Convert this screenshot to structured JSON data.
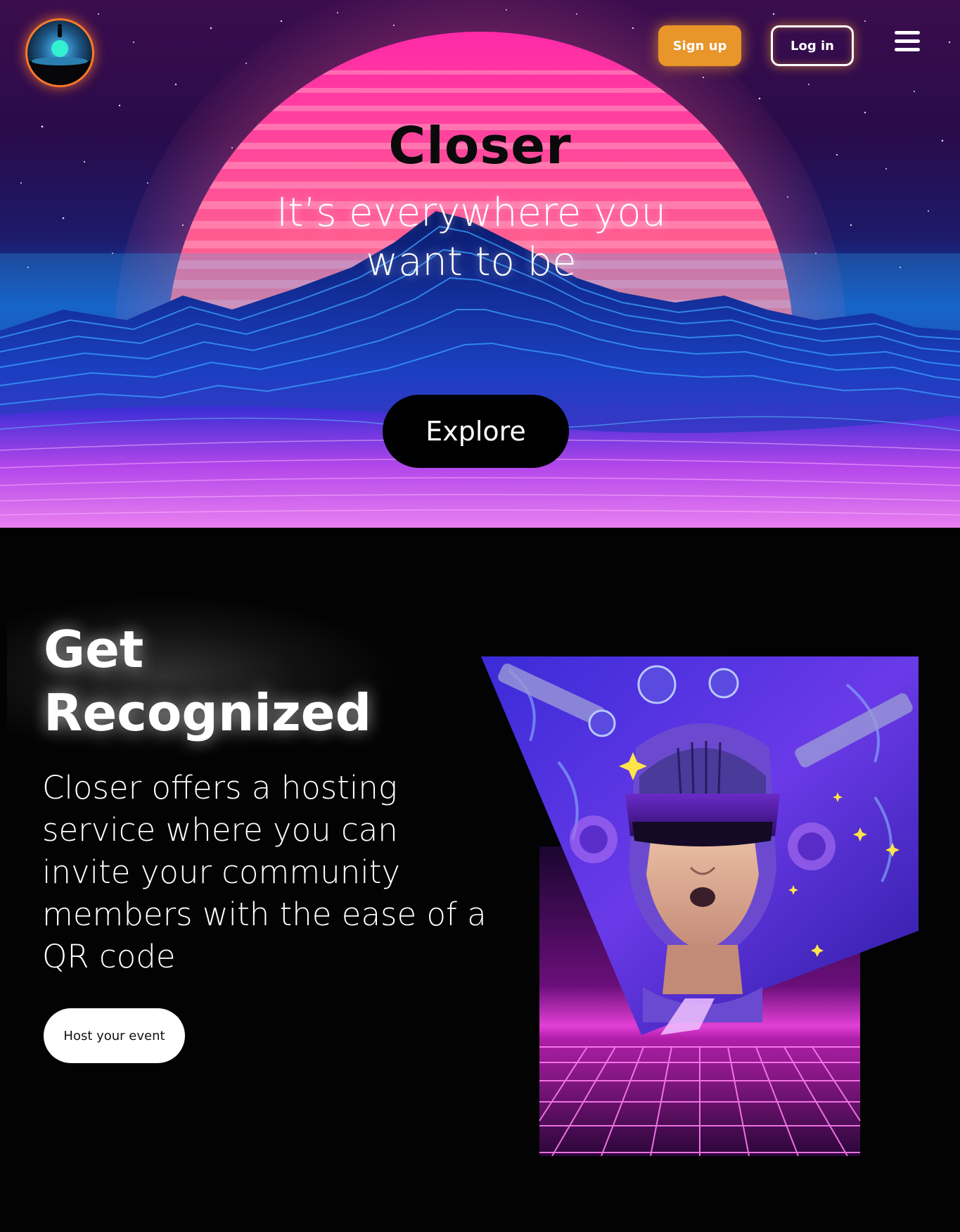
{
  "header": {
    "logo_icon": "planet-horizon-logo",
    "signup_label": "Sign up",
    "login_label": "Log in",
    "menu_icon": "hamburger-menu-icon"
  },
  "hero": {
    "title": "Closer",
    "subtitle": "It’s everywhere you want to be",
    "cta_label": "Explore"
  },
  "feature": {
    "heading": "Get Recognized",
    "body": "Closer offers a hosting service where you can invite your community members with the ease of a QR code",
    "cta_label": "Host your event",
    "illustration": "vr-headset-person-synthwave-grid"
  },
  "colors": {
    "signup_bg": "#e8952a",
    "logo_ring": "#ff7a2b",
    "section_bg": "#030303",
    "grid_magenta": "#ff5cf0"
  }
}
